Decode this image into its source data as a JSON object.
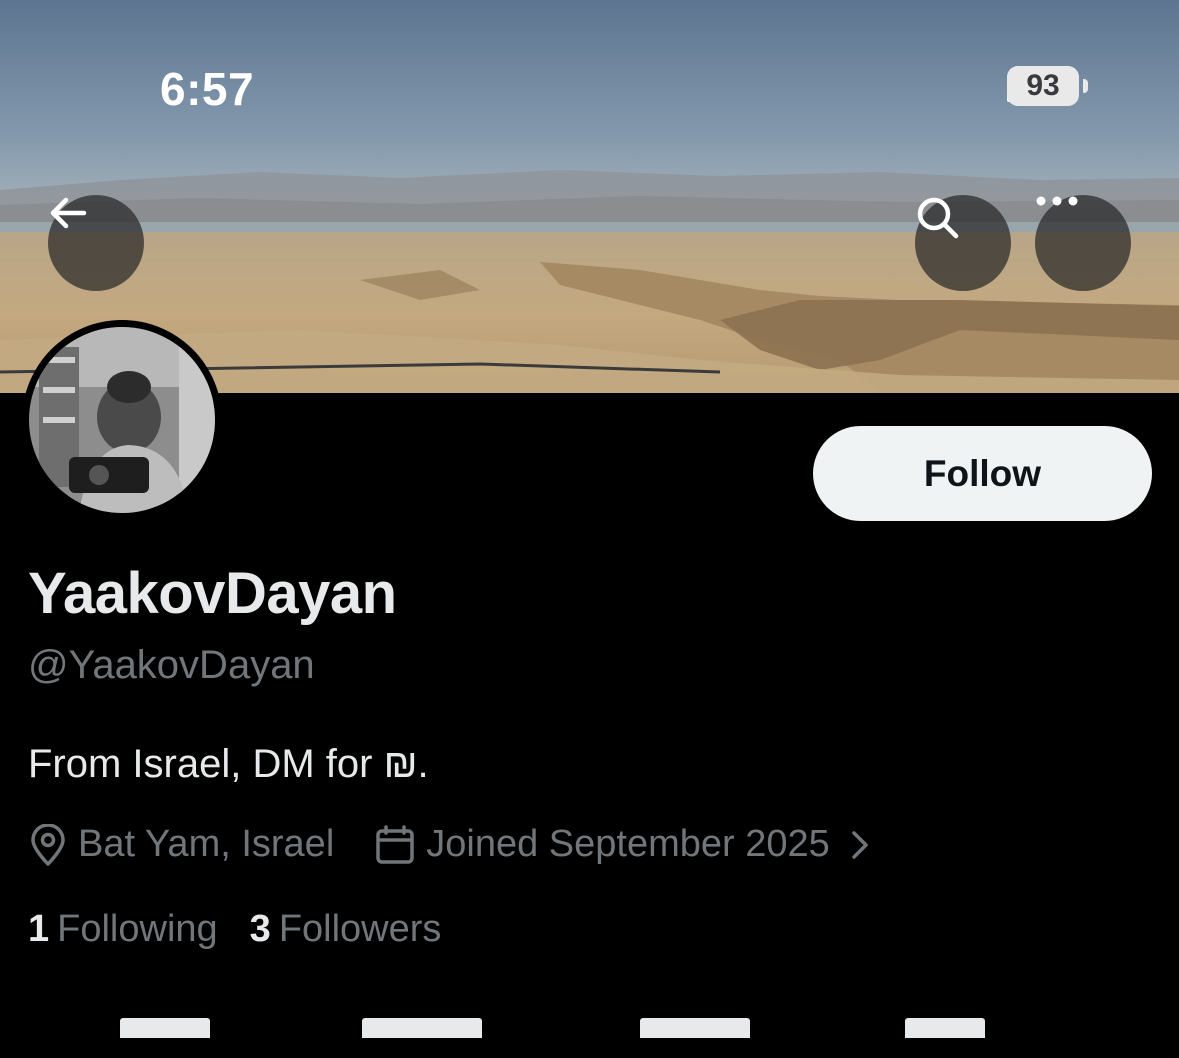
{
  "status_bar": {
    "time": "6:57",
    "battery": "93"
  },
  "nav": {
    "back_icon": "arrow-left-icon",
    "search_icon": "search-icon",
    "more_icon": "more-horizontal-icon"
  },
  "profile": {
    "display_name": "YaakovDayan",
    "handle": "@YaakovDayan",
    "bio": "From Israel, DM for ₪.",
    "location": "Bat Yam, Israel",
    "joined": "Joined September 2025",
    "following_count": "1",
    "following_label": "Following",
    "followers_count": "3",
    "followers_label": "Followers"
  },
  "actions": {
    "follow_label": "Follow"
  },
  "colors": {
    "background": "#000000",
    "primary_text": "#e7e9ea",
    "secondary_text": "#71767b",
    "follow_button_bg": "#eff3f4",
    "follow_button_text": "#0f1419"
  }
}
